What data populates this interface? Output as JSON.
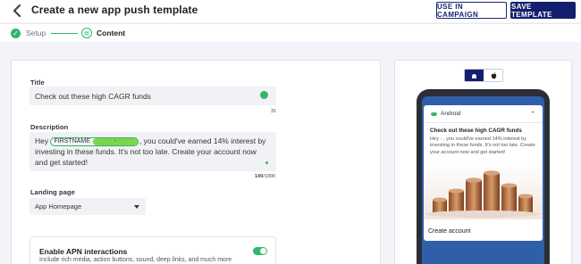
{
  "header": {
    "title": "Create a new app push template",
    "use_in_campaign": "USE IN CAMPAIGN",
    "save_template": "SAVE TEMPLATE"
  },
  "steps": [
    {
      "label": "Setup",
      "status": "completed"
    },
    {
      "label": "Content",
      "status": "current"
    }
  ],
  "form": {
    "title_label": "Title",
    "title_value": "Check out these high CAGR funds",
    "title_counter": "31",
    "description_label": "Description",
    "description_before": "Hey ",
    "description_chip_name": "FIRSTNAME",
    "description_chip_value": "-",
    "description_after": ", you could've earned 14% interest by investing in these funds. It's not too late. Create your account now and get started!",
    "description_counter_current": "140",
    "description_counter_max": "/1000",
    "landing_label": "Landing page",
    "landing_value": "App Homepage",
    "apn_title": "Enable APN interactions",
    "apn_subtitle": "Include rich media, action buttons, sound, deep links, and much more",
    "apn_enabled": true
  },
  "preview": {
    "platforms": [
      "android-icon",
      "apple-icon"
    ],
    "selected_platform": "android",
    "app_name": "Android",
    "notif_title": "Check out these high CAGR funds",
    "notif_body": "Hey  - , you could've earned 14% interest by investing in these funds. It's not too late. Create your account now and get started!",
    "cta": "Create account"
  },
  "colors": {
    "primary": "#131f6e",
    "success": "#32b66a",
    "chip_fill": "#7cd64a",
    "phone_screen": "#2f5fa9"
  }
}
